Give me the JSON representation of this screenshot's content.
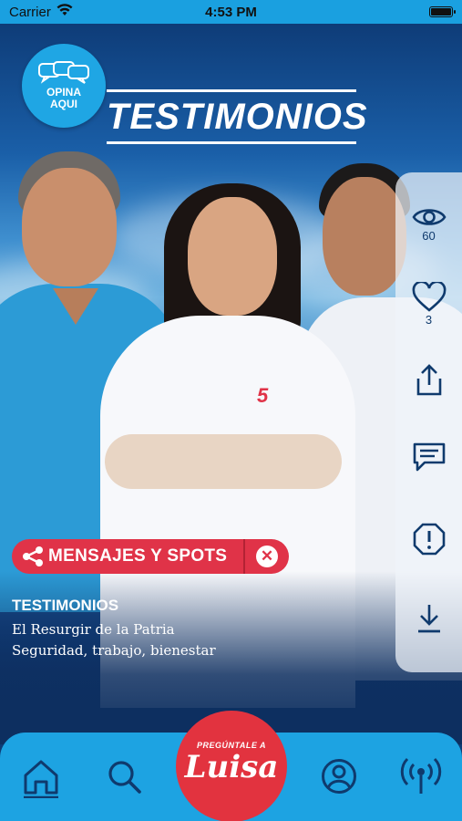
{
  "status_bar": {
    "carrier": "Carrier",
    "time": "4:53 PM"
  },
  "badge": {
    "line1": "OPINA",
    "line2": "AQUI"
  },
  "banner": {
    "title": "TESTIMONIOS"
  },
  "side_actions": [
    {
      "icon": "eye-icon",
      "count": "60"
    },
    {
      "icon": "heart-icon",
      "count": "3"
    },
    {
      "icon": "share-icon",
      "count": ""
    },
    {
      "icon": "comment-icon",
      "count": ""
    },
    {
      "icon": "report-icon",
      "count": ""
    },
    {
      "icon": "download-icon",
      "count": ""
    }
  ],
  "chip": {
    "label": "MENSAJES Y SPOTS",
    "close": "✕"
  },
  "caption": {
    "title": "TESTIMONIOS",
    "line1": "El Resurgir de la Patria",
    "line2": "Seguridad, trabajo, bienestar"
  },
  "nav": {
    "items": [
      "home-icon",
      "search-icon",
      "profile-icon",
      "broadcast-icon"
    ],
    "center_small": "PREGÚNTALE A",
    "center_big": "Luisa"
  },
  "colors": {
    "status_bg": "#1aa0e0",
    "nav_bg": "#1da3e2",
    "accent_red": "#e03348",
    "badge_blue": "#1fa6e4"
  }
}
